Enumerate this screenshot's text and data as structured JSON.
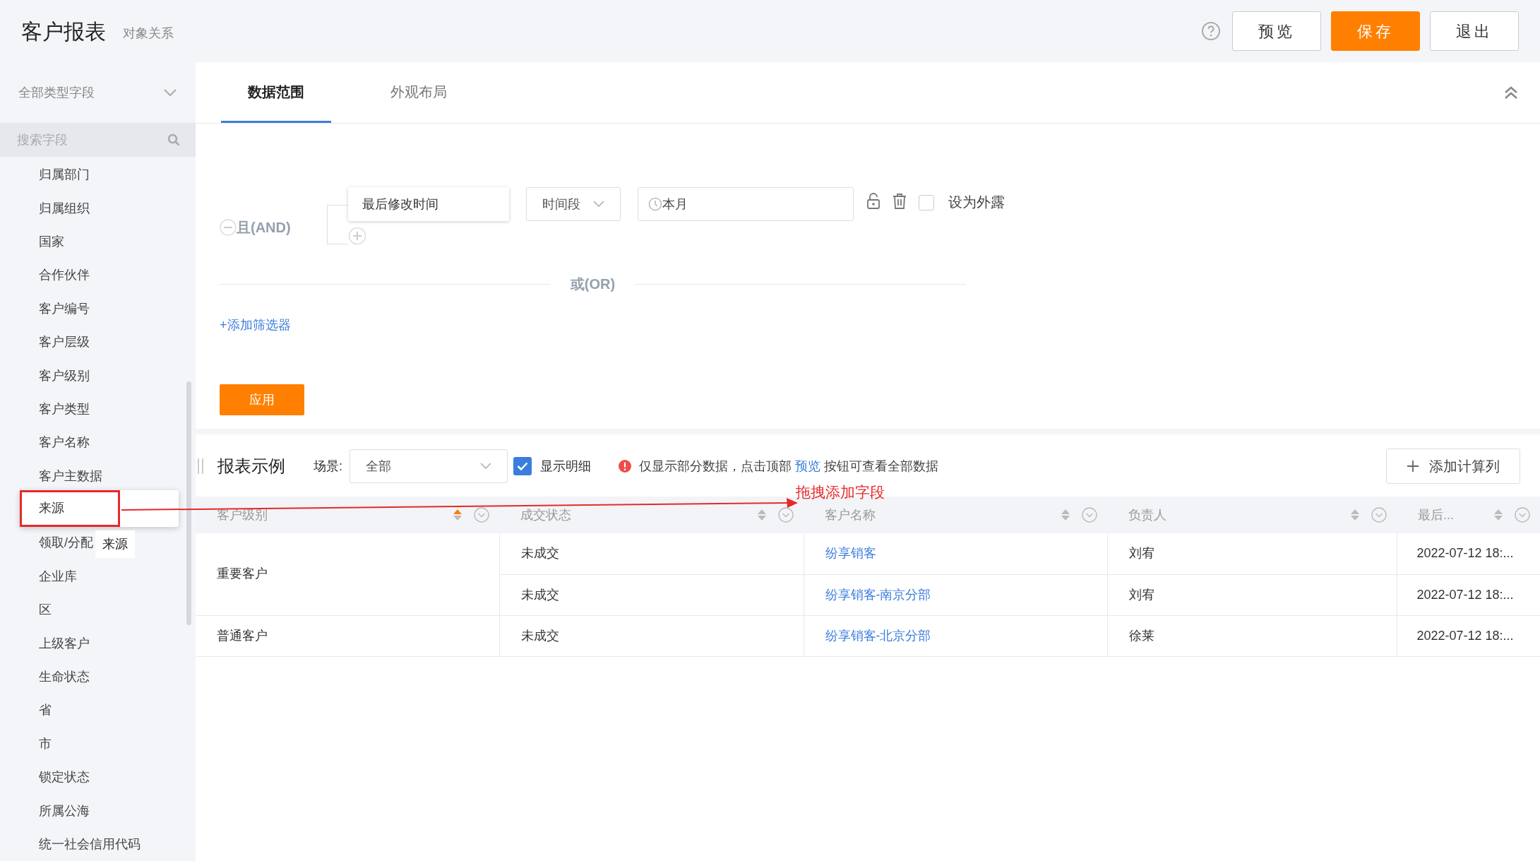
{
  "header": {
    "title": "客户报表",
    "subtitle": "对象关系",
    "buttons": [
      {
        "label": "预览",
        "kind": "default"
      },
      {
        "label": "保存",
        "kind": "primary"
      },
      {
        "label": "退出",
        "kind": "default"
      }
    ]
  },
  "sidebar": {
    "type_select": "全部类型字段",
    "search": {
      "placeholder": "搜索字段"
    },
    "items": [
      {
        "label": "归属部门",
        "dragging": false
      },
      {
        "label": "归属组织",
        "dragging": false
      },
      {
        "label": "国家",
        "dragging": false
      },
      {
        "label": "合作伙伴",
        "dragging": false
      },
      {
        "label": "客户编号",
        "dragging": false
      },
      {
        "label": "客户层级",
        "dragging": false
      },
      {
        "label": "客户级别",
        "dragging": false
      },
      {
        "label": "客户类型",
        "dragging": false
      },
      {
        "label": "客户名称",
        "dragging": false
      },
      {
        "label": "客户主数据",
        "dragging": false
      },
      {
        "label": "来源",
        "dragging": true
      },
      {
        "label": "领取/分配",
        "dragging": false
      },
      {
        "label": "企业库",
        "dragging": false
      },
      {
        "label": "区",
        "dragging": false
      },
      {
        "label": "上级客户",
        "dragging": false
      },
      {
        "label": "生命状态",
        "dragging": false
      },
      {
        "label": "省",
        "dragging": false
      },
      {
        "label": "市",
        "dragging": false
      },
      {
        "label": "锁定状态",
        "dragging": false
      },
      {
        "label": "所属公海",
        "dragging": false
      },
      {
        "label": "统一社会信用代码",
        "dragging": false
      }
    ],
    "drag_tooltip": "来源",
    "drag_hint": "拖拽添加字段"
  },
  "tabs": [
    {
      "label": "数据范围",
      "selected": true
    },
    {
      "label": "外观布局",
      "selected": false
    }
  ],
  "filter": {
    "and_label": "且(AND)",
    "field": "最后修改时间",
    "operator": "时间段",
    "value": "本月",
    "expose_checked": false,
    "expose_label": "设为外露",
    "or_label": "或(OR)",
    "add_filter": "+添加筛选器",
    "apply": "应用"
  },
  "report": {
    "title": "报表示例",
    "scene_label": "场景:",
    "scene_value": "全部",
    "show_detail": {
      "label": "显示明细",
      "checked": true
    },
    "notice_before": "仅显示部分数据，点击顶部",
    "notice_link": "预览",
    "notice_after": "按钮可查看全部数据",
    "add_column": "添加计算列",
    "columns": [
      {
        "label": "客户级别",
        "sorted_asc": true
      },
      {
        "label": "成交状态",
        "sorted_asc": false
      },
      {
        "label": "客户名称",
        "sorted_asc": false
      },
      {
        "label": "负责人",
        "sorted_asc": false
      },
      {
        "label": "最后...",
        "sorted_asc": false
      }
    ],
    "groups": [
      {
        "level": "重要客户",
        "rows": [
          {
            "status": "未成交",
            "name": "纷享销客",
            "owner": "刘宥",
            "time": "2022-07-12 18:..."
          },
          {
            "status": "未成交",
            "name": "纷享销客-南京分部",
            "owner": "刘宥",
            "time": "2022-07-12 18:..."
          }
        ]
      },
      {
        "level": "普通客户",
        "rows": [
          {
            "status": "未成交",
            "name": "纷享销客-北京分部",
            "owner": "徐莱",
            "time": "2022-07-12 18:..."
          }
        ]
      }
    ]
  }
}
